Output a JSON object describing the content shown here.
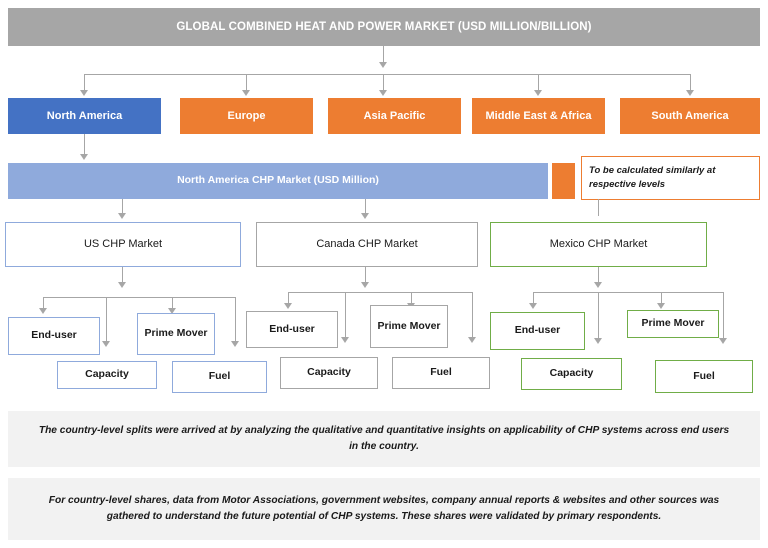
{
  "header": {
    "title": "GLOBAL COMBINED HEAT AND POWER MARKET (USD MILLION/BILLION)"
  },
  "regions": [
    {
      "label": "North America",
      "color": "#4472C4"
    },
    {
      "label": "Europe",
      "color": "#ED7D31"
    },
    {
      "label": "Asia Pacific",
      "color": "#ED7D31"
    },
    {
      "label": "Middle East & Africa",
      "color": "#ED7D31"
    },
    {
      "label": "South America",
      "color": "#ED7D31"
    }
  ],
  "na_bar": {
    "label": "North America CHP Market (USD Million)",
    "color": "#8FAADC"
  },
  "callout": {
    "text": "To be calculated similarly  at respective levels",
    "border_color": "#ED7D31",
    "swatch_color": "#ED7D31"
  },
  "countries": [
    {
      "label": "US CHP Market",
      "border_color": "#8FAADC"
    },
    {
      "label": "Canada CHP Market",
      "border_color": "#A6A6A6"
    },
    {
      "label": "Mexico CHP Market",
      "border_color": "#70AD47"
    }
  ],
  "segments": {
    "us": [
      {
        "label": "End-user"
      },
      {
        "label": "Capacity"
      },
      {
        "label": "Prime Mover"
      },
      {
        "label": "Fuel"
      }
    ],
    "canada": [
      {
        "label": "End-user"
      },
      {
        "label": "Capacity"
      },
      {
        "label": "Prime Mover"
      },
      {
        "label": "Fuel"
      }
    ],
    "mexico": [
      {
        "label": "End-user"
      },
      {
        "label": "Capacity"
      },
      {
        "label": "Prime Mover"
      },
      {
        "label": "Fuel"
      }
    ]
  },
  "notes": [
    {
      "text": "The country-level splits were arrived at by analyzing the qualitative and quantitative  insights on applicability of CHP systems across end users in the country."
    },
    {
      "text": "For country-level shares, data from Motor Associations, government websites, company annual reports & websites and other sources was gathered to understand the future potential of CHP systems. These shares were validated by primary respondents."
    }
  ]
}
